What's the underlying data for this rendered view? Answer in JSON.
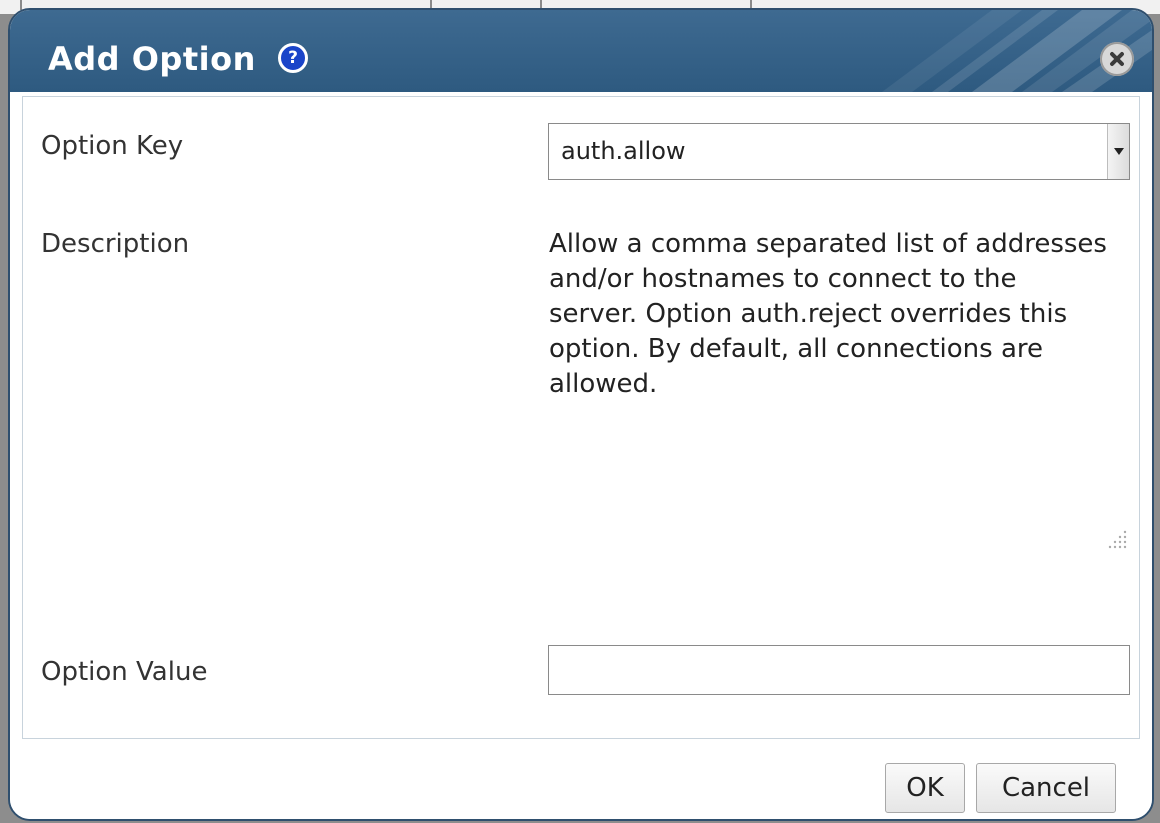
{
  "dialog": {
    "title": "Add Option",
    "help_icon": "help-icon",
    "close_icon": "close-icon"
  },
  "form": {
    "option_key_label": "Option Key",
    "option_key_value": "auth.allow",
    "description_label": "Description",
    "description_text": "Allow a comma separated list of addresses and/or hostnames to connect to the server. Option auth.reject overrides this option. By default, all connections are allowed.",
    "option_value_label": "Option Value",
    "option_value_value": ""
  },
  "buttons": {
    "ok_label": "OK",
    "cancel_label": "Cancel"
  },
  "colors": {
    "titlebar": "#2e5a80",
    "help_icon": "#1a44c9",
    "border": "#2f4f6e"
  }
}
